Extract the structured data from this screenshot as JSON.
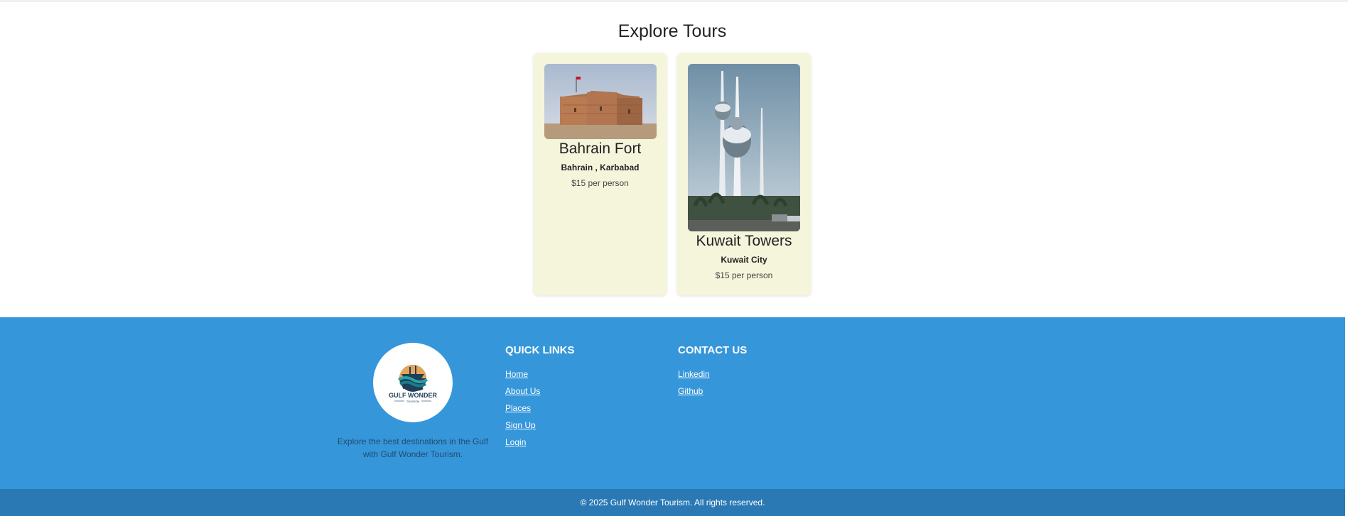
{
  "tours": {
    "title": "Explore Tours",
    "items": [
      {
        "name": "Bahrain Fort",
        "location": "Bahrain , Karbabad",
        "price": "$15 per person"
      },
      {
        "name": "Kuwait Towers",
        "location": "Kuwait City",
        "price": "$15 per person"
      }
    ]
  },
  "footer": {
    "logo_text": "GULF WONDER",
    "logo_subtext": "TOURISM",
    "description": "Explore the best destinations in the Gulf with Gulf Wonder Tourism.",
    "quick_links": {
      "title": "QUICK LINKS",
      "items": [
        "Home",
        "About Us",
        "Places",
        "Sign Up",
        "Login"
      ]
    },
    "contact": {
      "title": "CONTACT US",
      "items": [
        "Linkedin",
        "Github"
      ]
    },
    "copyright": "© 2025 Gulf Wonder Tourism. All rights reserved."
  },
  "colors": {
    "card_background": "#f5f5dc",
    "footer_background": "#3596da",
    "copyright_background": "#2a79b4"
  }
}
